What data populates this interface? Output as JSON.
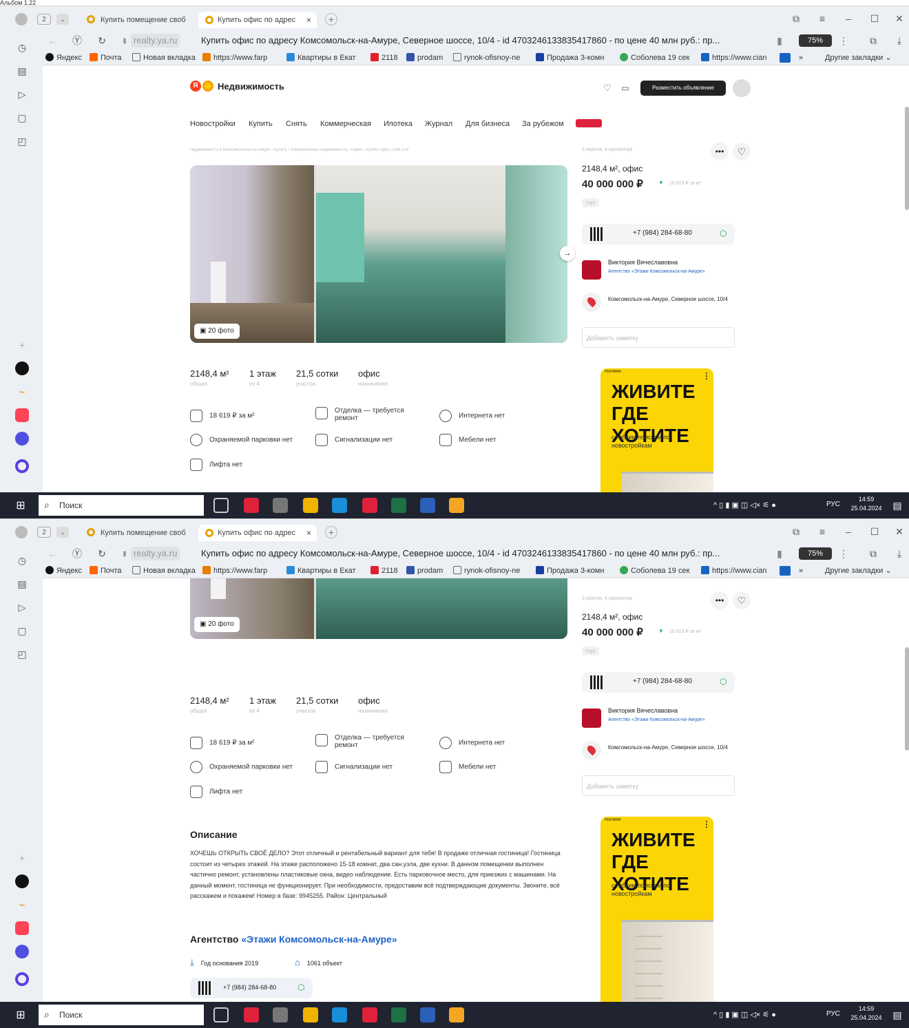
{
  "page_label": "Альбом 1.22",
  "browser": {
    "tab_count": "2",
    "tab1_title": "Купить помещение своб",
    "tab2_title": "Купить офис по адрес",
    "domain": "realty.ya.ru",
    "address_text": "Купить офис по адресу Комсомольск-на-Амуре, Северное шоссе, 10/4 - id 4703246133835417860 - по цене 40 млн руб.: пр...",
    "zoom": "75%",
    "bookmarks": [
      "Яндекс",
      "Почта",
      "Новая вкладка",
      "https://www.farp",
      "Квартиры в Екат",
      "2118",
      "prodam",
      "rynok-ofisnoy-ne",
      "Продажа 3-комн",
      "Соболева 19 сек",
      "https://www.cian"
    ],
    "bookmarks_more": "»",
    "other_bookmarks": "Другие закладки"
  },
  "site": {
    "logo_text": "Недвижимость",
    "post_ad_button": "Разместить объявление",
    "nav": [
      "Новостройки",
      "Купить",
      "Снять",
      "Коммерческая",
      "Ипотека",
      "Журнал",
      "Для бизнеса",
      "За рубежом"
    ],
    "breadcrumb": "Недвижимость в Комсомольске-на-Амуре › Купить › Коммерческая недвижимость › Офис › Купить офис 2148,4 м²",
    "views": "3 апреля, 4 просмотра",
    "area_type": "2148,4 м², офис",
    "price": "40 000 000 ₽",
    "price_per_m": "18 619 ₽ за м²",
    "bargain": "торг",
    "phone": "+7 (984) 284-68-80",
    "agent_name": "Виктория Вячеславовна",
    "agent_agency": "Агентство «Этажи Комсомольск-на-Амуре»",
    "address": "Комсомольск-на-Амуре, Северное шоссе, 10/4",
    "note_placeholder": "Добавить заметку",
    "photo_count": "20 фото",
    "specs": [
      {
        "value": "2148,4 м²",
        "label": "общая"
      },
      {
        "value": "1 этаж",
        "label": "из 4"
      },
      {
        "value": "21,5 сотки",
        "label": "участок"
      },
      {
        "value": "офис",
        "label": "назначение"
      }
    ],
    "features": [
      "18 619 ₽ за м²",
      "Отделка — требуется ремонт",
      "Интернета нет",
      "Охраняемой парковки нет",
      "Сигнализации нет",
      "Мебели нет",
      "Лифта нет"
    ],
    "ad": {
      "tag": "РЕКЛАМА",
      "line1": "ЖИВИТЕ",
      "line2": "ГДЕ ХОТИТЕ",
      "sub": "с гибким поиском по новостройкам"
    },
    "description_title": "Описание",
    "description": "ХОЧЕШЬ ОТКРЫТЬ СВОЁ ДЕЛО? Этот отличный и рентабельный вариант для тебя! В продаже отличная гостиница! Гостиница состоит из четырех этажей. На этаже расположено 15-18 комнат, два сан.узла, две кухни. В данном помещении выполнен частично ремонт, установлены пластиковые окна, видео наблюдение. Есть парковочное место, для приезжих с машинами. На данный момент, гостиница не функционирует. При необходимости, предоставим всё подтверждающие документы. Звоните, всё расскажем и покажем! Номер в базе: 9945255. Район: Центральный",
    "agency_prefix": "Агентство",
    "agency_link": "«Этажи Комсомольск-на-Амуре»",
    "founded": "Год основания 2019",
    "objects": "1061 объект"
  },
  "taskbar": {
    "search": "Поиск",
    "lang": "РУС",
    "time": "14:59",
    "date": "25.04.2024"
  },
  "colors": {
    "accent_yellow": "#fbd504",
    "brand_red": "#fc3f1d",
    "link_blue": "#1e62c8"
  }
}
